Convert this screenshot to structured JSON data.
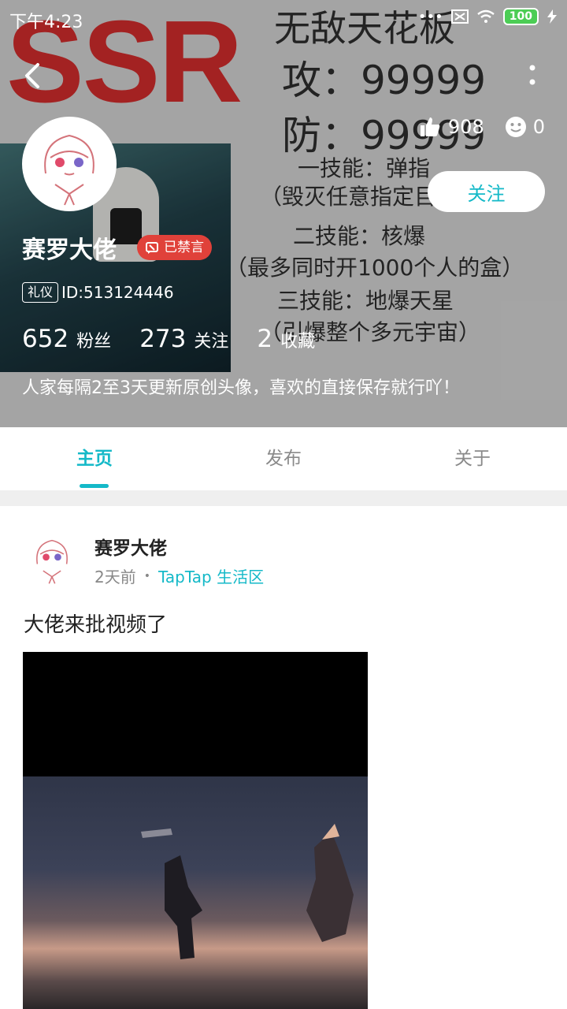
{
  "status_bar": {
    "time": "下午4:23",
    "battery": "100"
  },
  "profile": {
    "name": "赛罗大佬",
    "banned_label": "已禁言",
    "badge": "礼仪",
    "id_text": "ID:513124446",
    "likes": "908",
    "smiles": "0",
    "follow_label": "关注",
    "fans_count": "652",
    "fans_label": "粉丝",
    "following_count": "273",
    "following_label": "关注",
    "favorites_count": "2",
    "favorites_label": "收藏",
    "bio": "人家每隔2至3天更新原创头像，喜欢的直接保存就行吖！"
  },
  "background_image_text": {
    "big": "SSR",
    "lines": [
      "无敌天花板",
      "攻：99999",
      "防：99999",
      "一技能：弹指",
      "（毁灭任意指定目标）",
      "二技能：核爆",
      "（最多同时开1000个人的盒）",
      "三技能：地爆天星",
      "（引爆整个多元宇宙）"
    ]
  },
  "tabs": [
    {
      "label": "主页",
      "active": true
    },
    {
      "label": "发布",
      "active": false
    },
    {
      "label": "关于",
      "active": false
    }
  ],
  "post": {
    "author": "赛罗大佬",
    "time": "2天前",
    "forum": "TapTap 生活区",
    "title": "大佬来批视频了"
  },
  "colors": {
    "accent": "#14b9c8",
    "banned": "#e0413a"
  }
}
